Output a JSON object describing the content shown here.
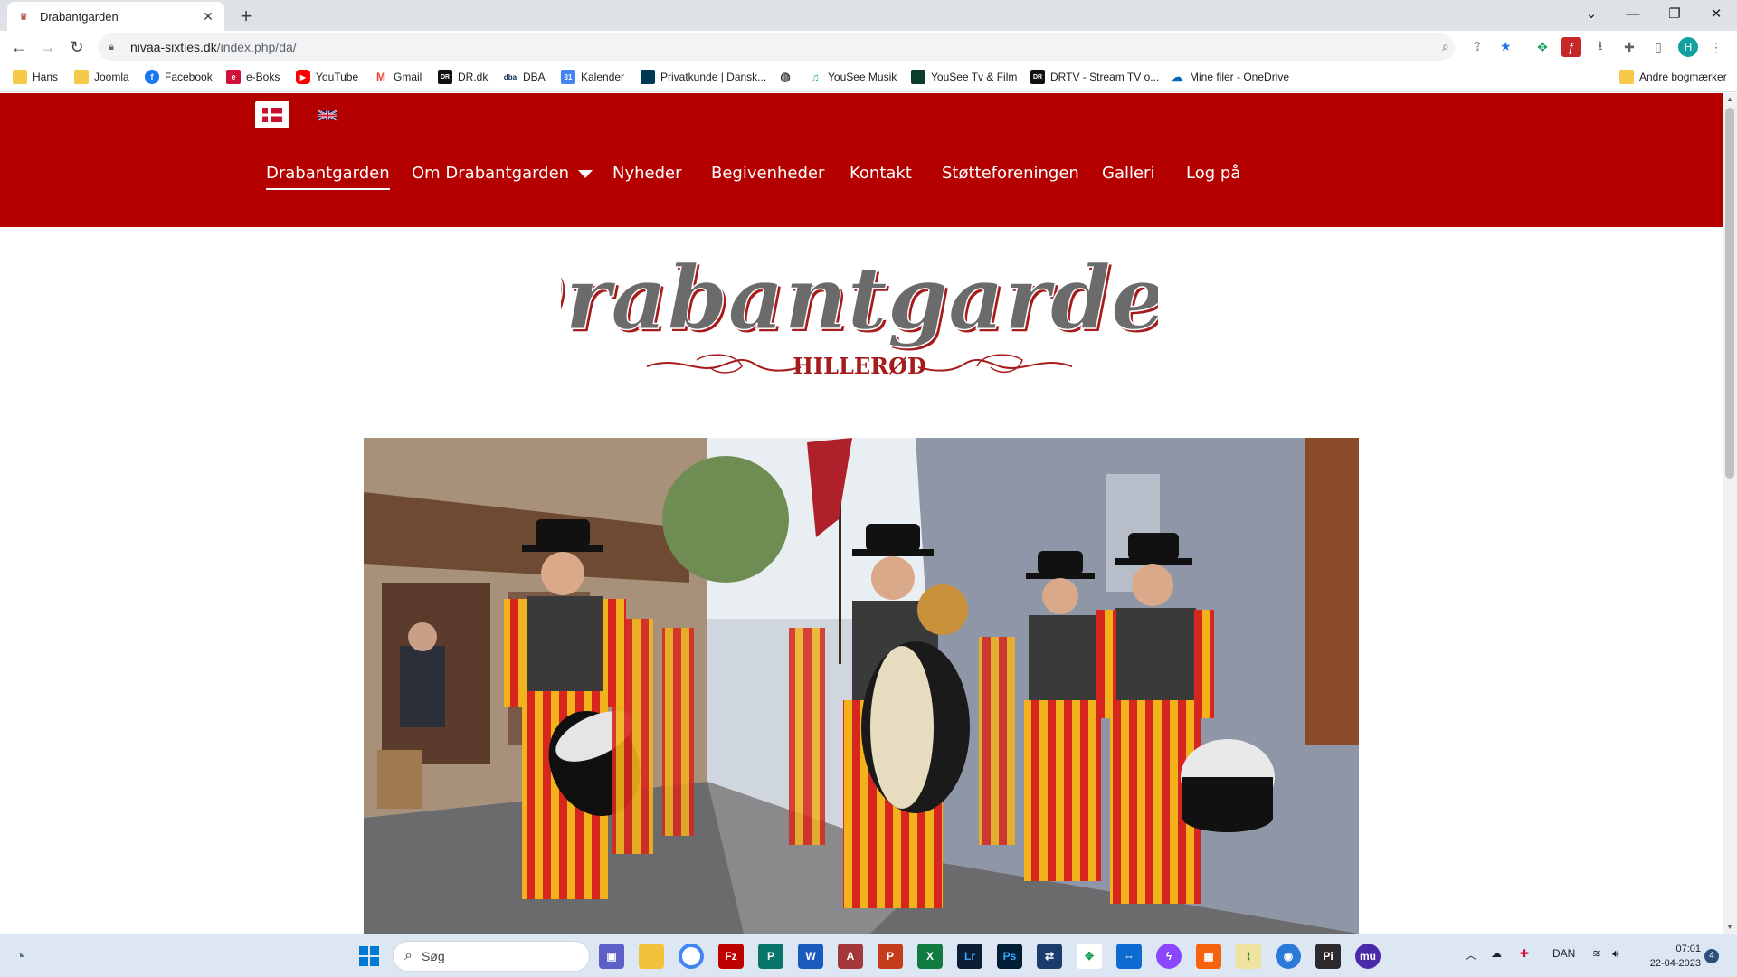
{
  "browser": {
    "tab_title": "Drabantgarden",
    "url_host": "nivaa-sixties.dk",
    "url_path": "/index.php/da/",
    "profile_initial": "H"
  },
  "bookmarks": [
    {
      "label": "Hans",
      "icon": "folder-icon"
    },
    {
      "label": "Joomla",
      "icon": "folder-icon"
    },
    {
      "label": "Facebook",
      "icon": "facebook-icon"
    },
    {
      "label": "e-Boks",
      "icon": "eboks-icon"
    },
    {
      "label": "YouTube",
      "icon": "youtube-icon"
    },
    {
      "label": "Gmail",
      "icon": "gmail-icon"
    },
    {
      "label": "DR.dk",
      "icon": "dr-icon"
    },
    {
      "label": "DBA",
      "icon": "dba-icon"
    },
    {
      "label": "Kalender",
      "icon": "calendar-icon"
    },
    {
      "label": "Privatkunde | Dansk...",
      "icon": "bank-icon"
    },
    {
      "label": "",
      "icon": "globe-icon"
    },
    {
      "label": "YouSee Musik",
      "icon": "music-icon"
    },
    {
      "label": "YouSee Tv & Film",
      "icon": "yousee-tv-icon"
    },
    {
      "label": "DRTV - Stream TV o...",
      "icon": "drtv-icon"
    },
    {
      "label": "Mine filer - OneDrive",
      "icon": "onedrive-icon"
    }
  ],
  "other_bookmarks": "Andre bogmærker",
  "site": {
    "nav": [
      {
        "label": "Drabantgarden",
        "active": true
      },
      {
        "label": "Om Drabantgarden",
        "dropdown": true
      },
      {
        "label": "Nyheder"
      },
      {
        "label": "Begivenheder"
      },
      {
        "label": "Kontakt"
      },
      {
        "label": "Støtteforeningen"
      },
      {
        "label": "Galleri"
      },
      {
        "label": "Log på"
      }
    ],
    "logo_title": "Drabantgarden",
    "logo_subtitle": "HILLERØD",
    "colors": {
      "brand_red": "#b50000",
      "logo_gray": "#6b6b6b",
      "logo_red": "#a61c1c"
    }
  },
  "taskbar": {
    "search_placeholder": "Søg",
    "language": "DAN",
    "time": "07:01",
    "date": "22-04-2023",
    "notifications": "4"
  }
}
